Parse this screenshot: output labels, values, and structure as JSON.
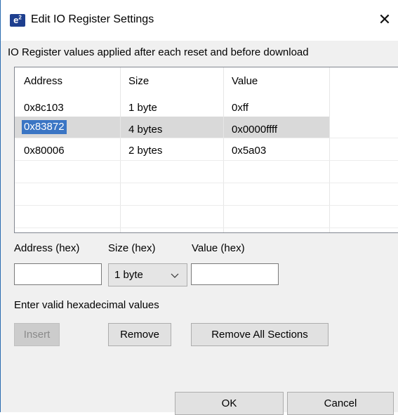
{
  "window": {
    "icon_text": "e",
    "icon_sup": "2",
    "title": "Edit IO Register Settings",
    "close_glyph": "✕"
  },
  "info": "IO Register values applied after each reset and before download",
  "table": {
    "headers": [
      "Address",
      "Size",
      "Value"
    ],
    "rows": [
      {
        "address": "0x8c103",
        "size": "1 byte",
        "value": "0xff"
      },
      {
        "address": "0x83872",
        "size": "4 bytes",
        "value": "0x0000ffff"
      },
      {
        "address": "0x80006",
        "size": "2 bytes",
        "value": "0x5a03"
      }
    ],
    "selected_row": 1
  },
  "form": {
    "address_label": "Address (hex)",
    "size_label": "Size (hex)",
    "value_label": "Value (hex)",
    "address_value": "",
    "size_selected": "1 byte",
    "value_value": ""
  },
  "hint": "Enter valid hexadecimal values",
  "buttons": {
    "insert": "Insert",
    "remove": "Remove",
    "remove_all": "Remove All Sections",
    "ok": "OK",
    "cancel": "Cancel"
  },
  "colors": {
    "accent": "#3a75c4",
    "selected_row": "#d9d9d9",
    "window_border": "#2b6cb0"
  }
}
